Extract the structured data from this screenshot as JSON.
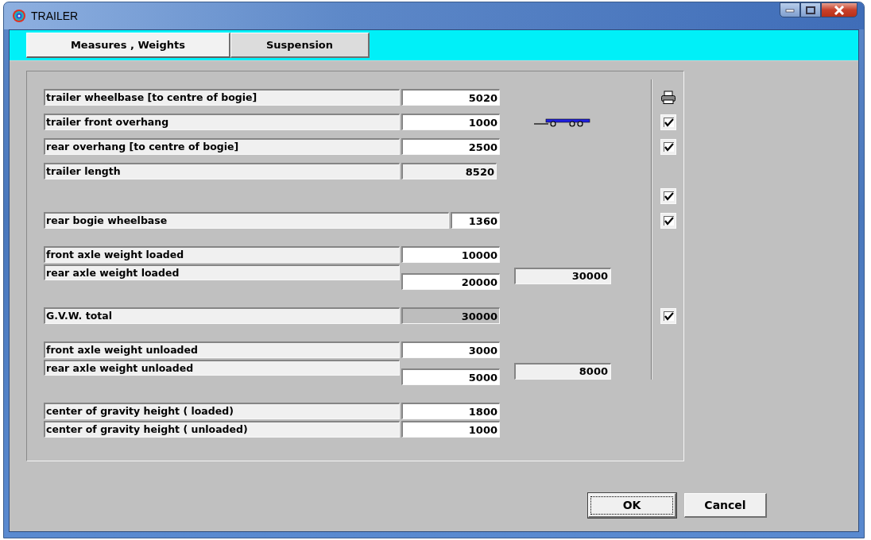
{
  "window": {
    "title": "TRAILER"
  },
  "tabs": [
    {
      "label": "Measures , Weights",
      "selected": true
    },
    {
      "label": "Suspension",
      "selected": false
    }
  ],
  "groups": [
    {
      "rows": [
        {
          "kind": "input",
          "label": "trailer wheelbase [to centre of bogie]",
          "value": "5020",
          "printer": true
        },
        {
          "kind": "input",
          "label": "trailer front overhang",
          "value": "1000",
          "trailer_drawing": true,
          "checked": true
        },
        {
          "kind": "input",
          "label": "rear overhang [to centre of bogie]",
          "value": "2500",
          "checked": true
        },
        {
          "kind": "readonly",
          "label": "trailer length",
          "value": "8520"
        },
        {
          "kind": "blank",
          "checked": true
        },
        {
          "kind": "short",
          "label": "rear bogie wheelbase",
          "value": "1360",
          "checked": true
        }
      ]
    },
    {
      "rows": [
        {
          "kind": "input",
          "label": "front axle weight loaded",
          "value": "10000"
        },
        {
          "kind": "split",
          "label": "rear axle weight loaded",
          "value": "20000",
          "total": "30000"
        }
      ]
    },
    {
      "rows": [
        {
          "kind": "computed",
          "label": "G.V.W. total",
          "value": "30000",
          "checked": true
        }
      ]
    },
    {
      "rows": [
        {
          "kind": "input",
          "label": "front axle weight unloaded",
          "value": "3000"
        },
        {
          "kind": "split",
          "label": "rear axle weight unloaded",
          "value": "5000",
          "total": "8000"
        }
      ]
    },
    {
      "rows": [
        {
          "kind": "input",
          "label": "center of gravity height  ( loaded)",
          "value": "1800"
        },
        {
          "kind": "input",
          "label": "center of gravity height  ( unloaded)",
          "value": "1000"
        }
      ]
    }
  ],
  "buttons": [
    {
      "label": "OK",
      "focused": true
    },
    {
      "label": "Cancel",
      "focused": false
    }
  ]
}
